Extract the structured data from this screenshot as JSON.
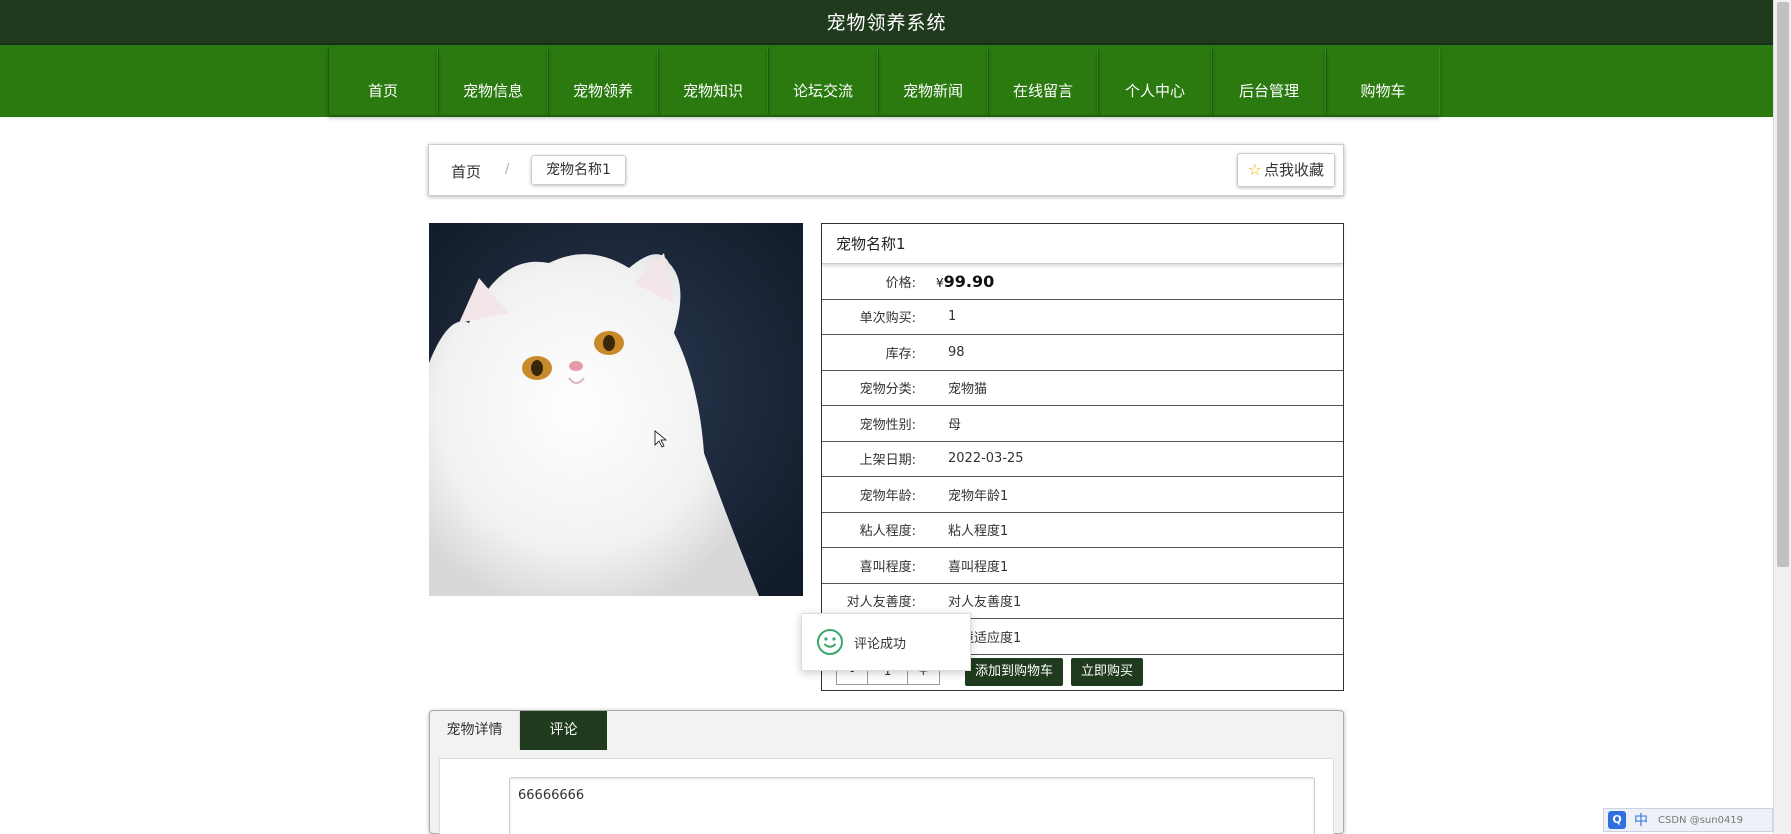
{
  "site": {
    "title": "宠物领养系统"
  },
  "nav": {
    "items": [
      {
        "label": "首页"
      },
      {
        "label": "宠物信息"
      },
      {
        "label": "宠物领养"
      },
      {
        "label": "宠物知识"
      },
      {
        "label": "论坛交流"
      },
      {
        "label": "宠物新闻"
      },
      {
        "label": "在线留言"
      },
      {
        "label": "个人中心"
      },
      {
        "label": "后台管理"
      },
      {
        "label": "购物车"
      }
    ]
  },
  "breadcrumb": {
    "home": "首页",
    "separator": "/",
    "current": "宠物名称1"
  },
  "favorite": {
    "label": "点我收藏",
    "icon": "star-icon"
  },
  "product": {
    "name": "宠物名称1",
    "price_label": "价格:",
    "currency": "¥",
    "price": "99.90",
    "fields": [
      {
        "label": "单次购买:",
        "value": "1"
      },
      {
        "label": "库存:",
        "value": "98"
      },
      {
        "label": "宠物分类:",
        "value": "宠物猫"
      },
      {
        "label": "宠物性别:",
        "value": "母"
      },
      {
        "label": "上架日期:",
        "value": "2022-03-25"
      },
      {
        "label": "宠物年龄:",
        "value": "宠物年龄1"
      },
      {
        "label": "粘人程度:",
        "value": "粘人程度1"
      },
      {
        "label": "喜叫程度:",
        "value": "喜叫程度1"
      },
      {
        "label": "对人友善度:",
        "value": "对人友善度1"
      },
      {
        "label": "",
        "value": "环境适应度1"
      }
    ],
    "quantity": {
      "minus": "-",
      "value": "1",
      "plus": "+"
    },
    "add_to_cart_label": "添加到购物车",
    "buy_now_label": "立即购买"
  },
  "toast": {
    "message": "评论成功",
    "icon": "smile-icon"
  },
  "tabs": {
    "items": [
      {
        "label": "宠物详情"
      },
      {
        "label": "评论"
      }
    ],
    "active": "评论"
  },
  "comment": {
    "label": "评论",
    "value": "66666666"
  },
  "ime": {
    "logo": "Q",
    "mode": "中",
    "extra": "CSDN @sun0419"
  },
  "colors": {
    "header_dark": "#1f3a1c",
    "nav_green": "#2a7a10",
    "button_dark": "#1f3a1c"
  }
}
